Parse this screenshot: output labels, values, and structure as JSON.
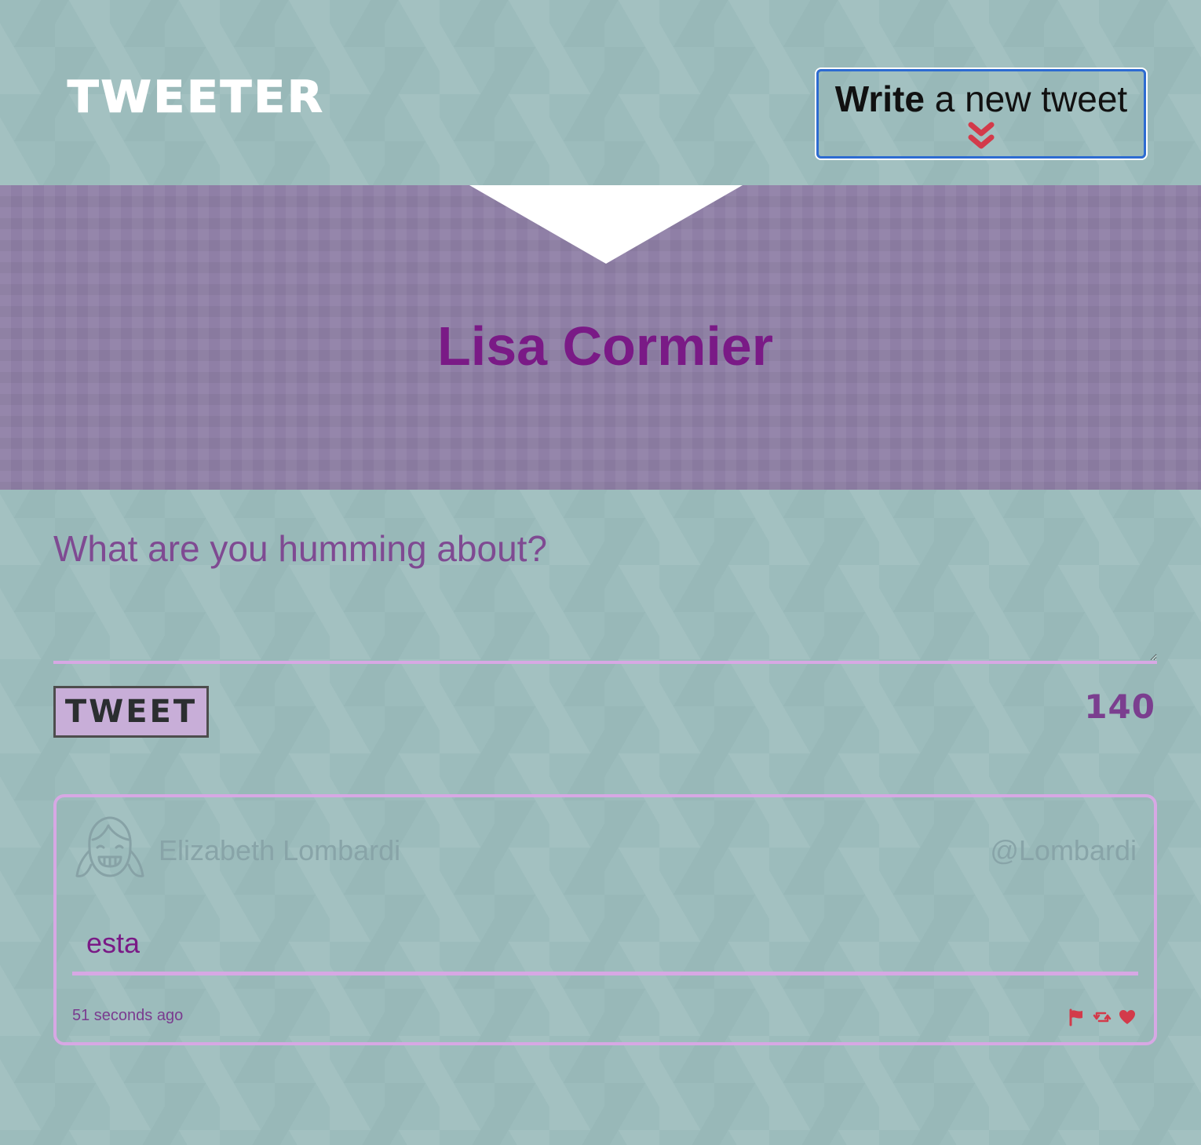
{
  "nav": {
    "brand": "TWEETER",
    "compose_toggle": {
      "strong": "Write",
      "rest": " a new tweet",
      "icon": "double-chevron-down-icon"
    }
  },
  "profile": {
    "name": "Lisa Cormier"
  },
  "compose": {
    "placeholder": "What are you humming about?",
    "value": "",
    "submit_label": "TWEET",
    "counter": "140"
  },
  "tweets": [
    {
      "avatar_icon": "girl-avatar-icon",
      "name": "Elizabeth Lombardi",
      "handle": "@Lombardi",
      "text": "esta",
      "timestamp": "51 seconds ago",
      "actions": [
        "flag-icon",
        "retweet-icon",
        "heart-icon"
      ]
    }
  ],
  "colors": {
    "background": "#9cbcbc",
    "band": "#8f7fa6",
    "accent_purple": "#7a1a86",
    "border_pink": "#d7a8e4",
    "action_red": "#d33a4a",
    "focus_blue": "#2d6bd1"
  }
}
